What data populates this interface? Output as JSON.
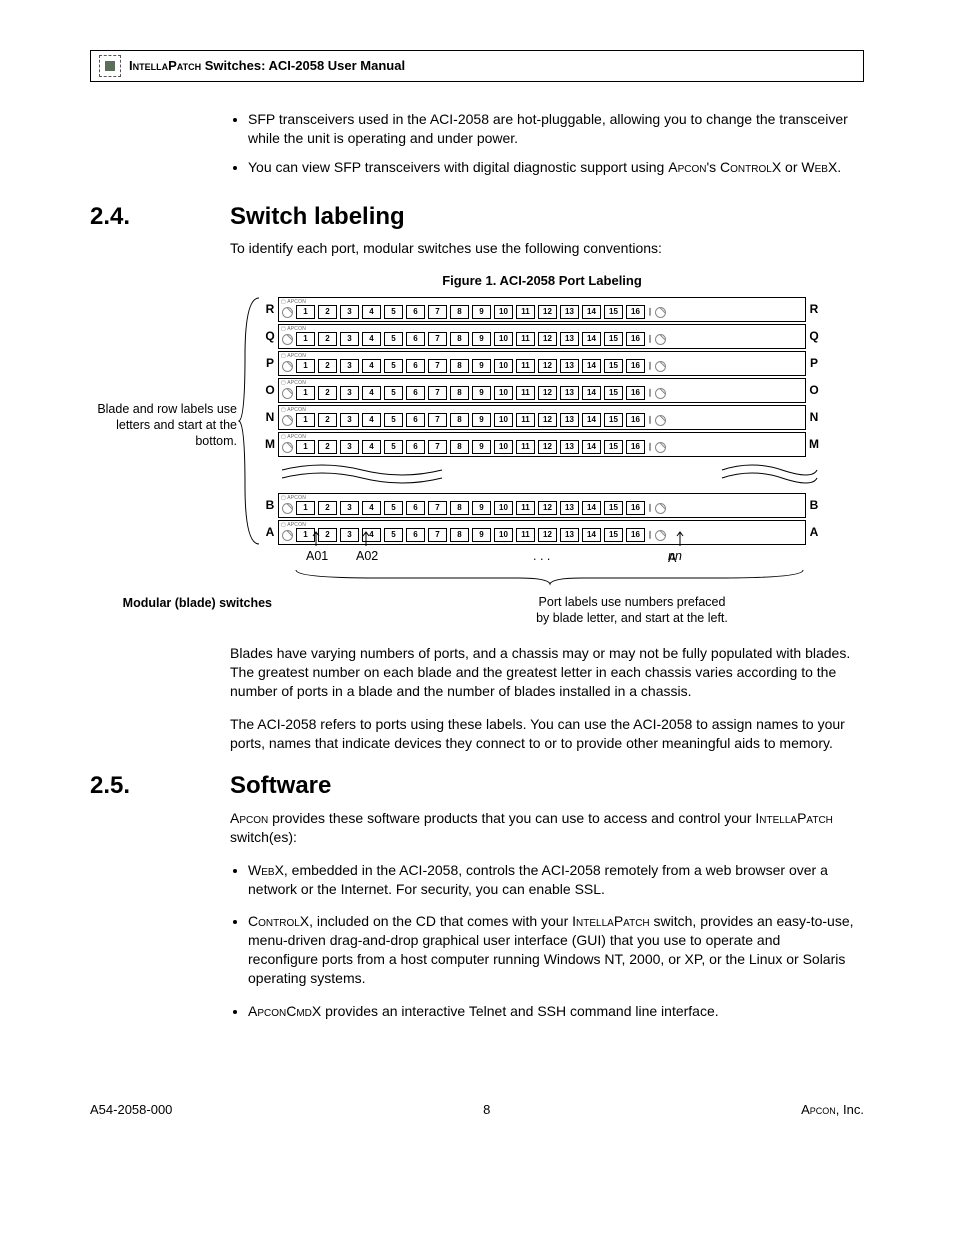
{
  "header": {
    "brand": "IntellaPatch",
    "rest": " Switches: ACI-2058 User Manual"
  },
  "intro_bullets": [
    "SFP transceivers used in the ACI-2058 are hot-pluggable, allowing you to change the transceiver while the unit is operating and under power.",
    "You can view SFP transceivers with digital diagnostic support using Apcon's ControlX or WebX."
  ],
  "s24": {
    "num": "2.4.",
    "title": "Switch labeling",
    "lead": "To identify each port, modular switches use the following conventions:",
    "fig_caption": "Figure 1. ACI-2058 Port Labeling",
    "anno_left": "Blade and row labels use letters and start at the bottom.",
    "rows_top": [
      "R",
      "Q",
      "P",
      "O",
      "N",
      "M"
    ],
    "rows_bot": [
      "B",
      "A"
    ],
    "ports": [
      "1",
      "2",
      "3",
      "4",
      "5",
      "6",
      "7",
      "8",
      "9",
      "10",
      "11",
      "12",
      "13",
      "14",
      "15",
      "16"
    ],
    "blade_logo": "▢ APCON",
    "modular_label": "Modular (blade) switches",
    "callout_a01": "A01",
    "callout_a02": "A02",
    "callout_dots": ". . .",
    "callout_ann_prefix": "A",
    "callout_ann_suffix": "nn",
    "port_note_l1": "Port labels use numbers prefaced",
    "port_note_l2": "by blade letter, and start at the left.",
    "p_after1": "Blades have varying numbers of ports, and a chassis may or may not be fully populated with blades. The greatest number on each blade and the greatest letter in each chassis varies according to the number of ports in a blade and the number of blades installed in a chassis.",
    "p_after2": "The ACI-2058 refers to ports using these labels. You can use the ACI-2058 to assign names to your ports, names that indicate devices they connect to or to provide other meaningful aids to memory."
  },
  "s25": {
    "num": "2.5.",
    "title": "Software",
    "lead_pre": "Apcon",
    "lead_mid": " provides these software products that you can use to access and control your ",
    "lead_brand": "IntellaPatch",
    "lead_post": " switch(es):",
    "b1_pre": "Web",
    "b1_x": "X, embedded in the ACI-2058, controls the ACI-2058 remotely from a web browser over a network or the Internet. For security, you can enable SSL.",
    "b2_pre": "Control",
    "b2_mid": "X, included on the CD that comes with your ",
    "b2_brand": "IntellaPatch",
    "b2_post": " switch, provides an easy-to-use, menu-driven drag-and-drop graphical user interface (GUI) that you use to operate and reconfigure ports from a host computer running Windows NT, 2000, or XP, or the Linux or Solaris operating systems.",
    "b3_pre": "ApconCmd",
    "b3_post": "X provides an interactive Telnet and SSH command line interface."
  },
  "footer": {
    "left": "A54-2058-000",
    "center": "8",
    "right_pre": "Apcon",
    "right_post": ", Inc."
  }
}
